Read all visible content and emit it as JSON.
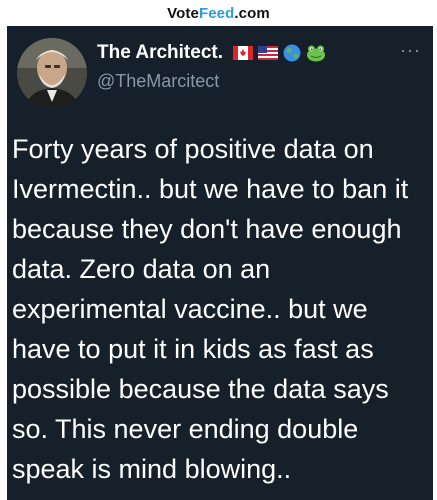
{
  "watermark": {
    "prefix": "Vote",
    "accent": "Feed",
    "suffix": ".com",
    "accent_color": "#2aa0d8"
  },
  "tweet": {
    "display_name": "The Architect.",
    "handle": "@TheMarcitect",
    "more_icon": "more-horizontal-icon",
    "name_icons": [
      "canada-flag-icon",
      "usa-flag-icon",
      "globe-icon",
      "frog-icon"
    ],
    "text": "Forty years of positive data on\nIvermectin.. but we have to ban it\nbecause they don't have enough\ndata. Zero data on an\nexperimental vaccine.. but we\nhave to put it in kids as fast as\npossible because the data says\nso. This never ending double\nspeak is mind blowing.."
  },
  "colors": {
    "background": "#15202b",
    "text": "#ffffff",
    "secondary": "#8899a6"
  }
}
